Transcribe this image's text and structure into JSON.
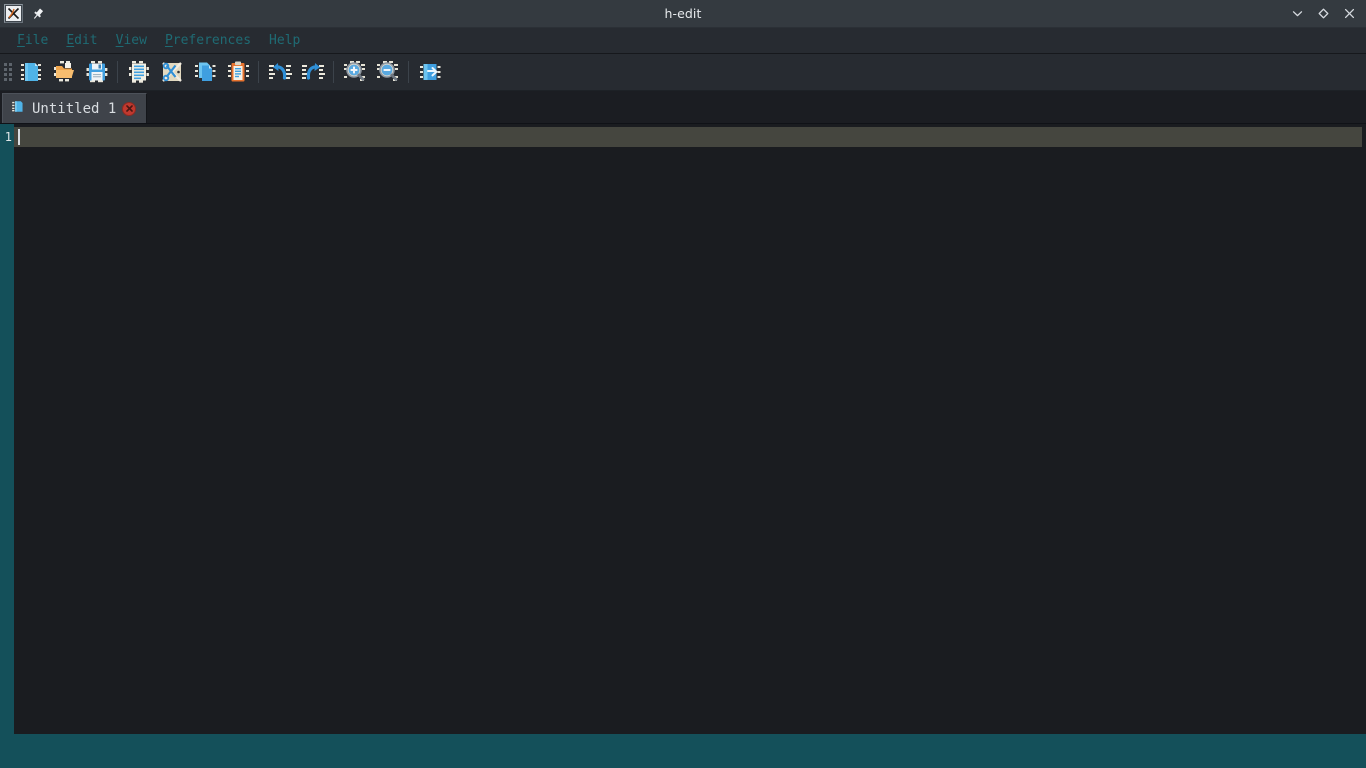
{
  "window": {
    "title": "h-edit",
    "app_icon": "x-logo-icon",
    "pin_icon": "pushpin-icon",
    "controls": [
      {
        "name": "minimize-button",
        "icon": "chevron-down-icon",
        "glyph": "⌄"
      },
      {
        "name": "maximize-button",
        "icon": "diamond-icon",
        "glyph": "◇"
      },
      {
        "name": "close-button",
        "icon": "close-x-icon",
        "glyph": "✕"
      }
    ]
  },
  "menubar": {
    "items": [
      {
        "name": "menu-file",
        "mnemonic": "F",
        "rest": "ile"
      },
      {
        "name": "menu-edit",
        "mnemonic": "E",
        "rest": "dit"
      },
      {
        "name": "menu-view",
        "mnemonic": "V",
        "rest": "iew"
      },
      {
        "name": "menu-preferences",
        "mnemonic": "P",
        "rest": "references"
      },
      {
        "name": "menu-help",
        "mnemonic": "",
        "rest": "Help"
      }
    ]
  },
  "toolbar": {
    "grip": "drag-handle",
    "buttons": [
      {
        "name": "new-file-button",
        "icon": "new-document-icon",
        "label": "New"
      },
      {
        "name": "open-file-button",
        "icon": "open-folder-icon",
        "label": "Open"
      },
      {
        "name": "save-file-button",
        "icon": "floppy-disk-save-icon",
        "label": "Save"
      },
      {
        "name": "separator-1",
        "icon": "toolbar-separator",
        "label": ""
      },
      {
        "name": "select-all-button",
        "icon": "document-lines-icon",
        "label": "Select All"
      },
      {
        "name": "cut-button",
        "icon": "scissors-cut-icon",
        "label": "Cut"
      },
      {
        "name": "copy-button",
        "icon": "copy-documents-icon",
        "label": "Copy"
      },
      {
        "name": "paste-button",
        "icon": "clipboard-paste-icon",
        "label": "Paste"
      },
      {
        "name": "separator-2",
        "icon": "toolbar-separator",
        "label": ""
      },
      {
        "name": "undo-button",
        "icon": "undo-arrow-icon",
        "label": "Undo"
      },
      {
        "name": "redo-button",
        "icon": "redo-arrow-icon",
        "label": "Redo"
      },
      {
        "name": "separator-3",
        "icon": "toolbar-separator",
        "label": ""
      },
      {
        "name": "zoom-in-button",
        "icon": "magnifier-plus-icon",
        "label": "Zoom In"
      },
      {
        "name": "zoom-out-button",
        "icon": "magnifier-minus-icon",
        "label": "Zoom Out"
      },
      {
        "name": "separator-4",
        "icon": "toolbar-separator",
        "label": ""
      },
      {
        "name": "goto-line-button",
        "icon": "page-arrow-right-icon",
        "label": "Go To"
      }
    ]
  },
  "tabs": [
    {
      "name": "tab-untitled-1",
      "icon": "file-tab-icon",
      "label": "Untitled 1",
      "close_icon": "tab-close-icon",
      "active": true
    }
  ],
  "editor": {
    "line_numbers": [
      "1"
    ],
    "lines": [
      ""
    ],
    "cursor_line": 1,
    "cursor_column": 1,
    "current_line_highlight": true
  },
  "statusbar": {
    "text": ""
  },
  "colors": {
    "titlebar_bg": "#343a40",
    "menubar_bg": "#272b31",
    "menu_text": "#1f6b74",
    "toolbar_bg": "#272b31",
    "tab_active_bg": "#3f434a",
    "editor_bg": "#1a1c20",
    "gutter_bg": "#14505a",
    "current_line_bg": "#45463f",
    "statusbar_bg": "#14505a",
    "tab_close_red": "#c0392f"
  }
}
